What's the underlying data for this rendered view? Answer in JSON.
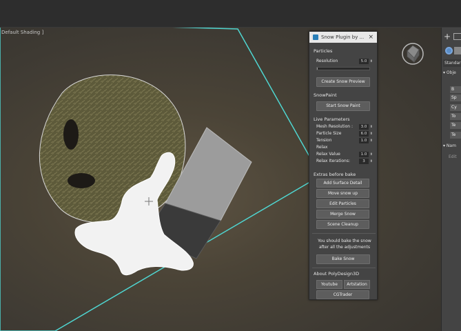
{
  "viewport": {
    "label": "Default Shading ]"
  },
  "panel": {
    "title": "Snow Plugin by ...",
    "close": "×",
    "particles": {
      "heading": "Particles",
      "resolution_label": "Resolution",
      "resolution_value": "5.0",
      "create_preview": "Create Snow Preview"
    },
    "snowpaint": {
      "heading": "SnowPaint",
      "start": "Start Snow Paint"
    },
    "live": {
      "heading": "Live Parameters",
      "rows": [
        {
          "label": "Mesh Resolution :",
          "value": "3.0"
        },
        {
          "label": "Particle Size",
          "value": "6.0"
        },
        {
          "label": "Tension",
          "value": "1.0"
        }
      ],
      "relax_heading": "Relax",
      "relax_rows": [
        {
          "label": "Relax Value",
          "value": "1.0"
        },
        {
          "label": "Relax Iterations:",
          "value": "3"
        }
      ]
    },
    "extras": {
      "heading": "Extras before bake",
      "buttons": [
        "Add Surface Detail",
        "Move snow up",
        "Edit Particles",
        "Merge Snow",
        "Scene Cleanup"
      ]
    },
    "bake": {
      "note_line1": "You should bake the snow",
      "note_line2": "after all the adjustments",
      "button": "Bake Snow"
    },
    "about": {
      "heading": "About PolyDesign3D",
      "youtube": "Youtube",
      "artstation": "Artstation",
      "cgtrader": "CGTrader"
    }
  },
  "command_panel": {
    "standard": "Standar",
    "object_header": "▾ Obje",
    "items": [
      "B",
      "Sp",
      "Cy",
      "To",
      "Te",
      "Te"
    ],
    "name_header": "▾ Nam",
    "name_value": "Edit"
  },
  "colors": {
    "selection": "#4fd6d1",
    "snow": "#f2f2f2",
    "ground": "#4f473a"
  }
}
